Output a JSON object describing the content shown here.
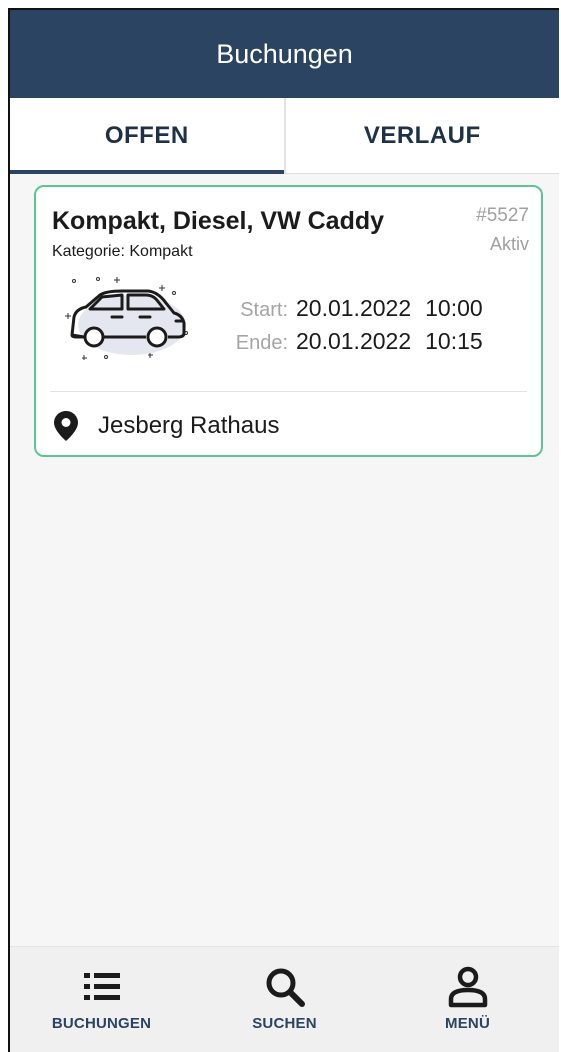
{
  "header": {
    "title": "Buchungen"
  },
  "tabs": [
    {
      "label": "OFFEN",
      "active": true
    },
    {
      "label": "VERLAUF",
      "active": false
    }
  ],
  "booking": {
    "title": "Kompakt, Diesel, VW Caddy",
    "category": "Kategorie: Kompakt",
    "id": "#5527",
    "status": "Aktiv",
    "start_label": "Start:",
    "start_date": "20.01.2022",
    "start_time": "10:00",
    "end_label": "Ende:",
    "end_date": "20.01.2022",
    "end_time": "10:15",
    "location": "Jesberg Rathaus"
  },
  "bottom_nav": [
    {
      "label": "BUCHUNGEN",
      "icon": "list-icon"
    },
    {
      "label": "SUCHEN",
      "icon": "search-icon"
    },
    {
      "label": "MENÜ",
      "icon": "person-icon"
    }
  ],
  "colors": {
    "primary": "#2b4462",
    "card_border": "#5cc594",
    "background": "#f6f6f6"
  }
}
